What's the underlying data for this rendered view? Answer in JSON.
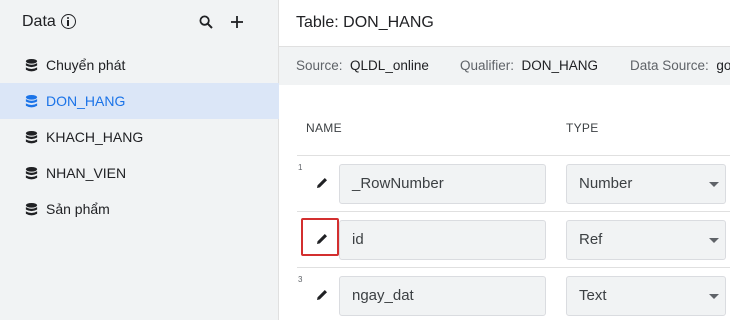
{
  "sidebar": {
    "title": "Data",
    "icons": {
      "info": "info-icon",
      "search": "search-icon",
      "add": "add-icon",
      "table": "database-icon"
    },
    "items": [
      {
        "label": "Chuyển phát",
        "active": false
      },
      {
        "label": "DON_HANG",
        "active": true
      },
      {
        "label": "KHACH_HANG",
        "active": false
      },
      {
        "label": "NHAN_VIEN",
        "active": false
      },
      {
        "label": "Sản phẩm",
        "active": false
      }
    ]
  },
  "main": {
    "title": "Table: DON_HANG",
    "meta": {
      "source_label": "Source:",
      "source_value": "QLDL_online",
      "qualifier_label": "Qualifier:",
      "qualifier_value": "DON_HANG",
      "datasource_label": "Data Source:",
      "datasource_value": "go"
    },
    "columns": {
      "name": "NAME",
      "type": "TYPE"
    },
    "rows": [
      {
        "num": "1",
        "name": "_RowNumber",
        "type": "Number"
      },
      {
        "num": "",
        "name": "id",
        "type": "Ref",
        "highlighted": true
      },
      {
        "num": "3",
        "name": "ngay_dat",
        "type": "Text"
      }
    ]
  },
  "colors": {
    "accent": "#1a73e8",
    "active_bg": "#dbe6f7",
    "highlight": "#d32f2f",
    "panel_bg": "#f1f3f4"
  }
}
